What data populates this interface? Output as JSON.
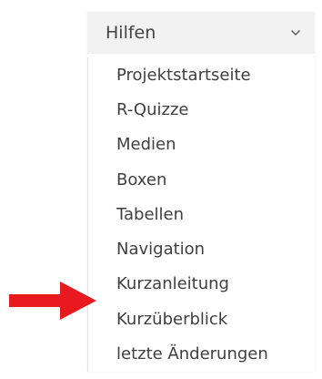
{
  "menu": {
    "title": "Hilfen",
    "expand_icon": "chevron-down-icon",
    "items": [
      {
        "label": "Projektstartseite"
      },
      {
        "label": "R-Quizze"
      },
      {
        "label": "Medien"
      },
      {
        "label": "Boxen"
      },
      {
        "label": "Tabellen"
      },
      {
        "label": "Navigation"
      },
      {
        "label": "Kurzanleitung"
      },
      {
        "label": "Kurzüberblick"
      },
      {
        "label": "letzte Änderungen"
      }
    ]
  },
  "annotation": {
    "icon": "arrow-right-icon",
    "color": "#e8191f"
  },
  "colors": {
    "header_background": "#f2f2f2",
    "text": "#3f3f3f"
  }
}
